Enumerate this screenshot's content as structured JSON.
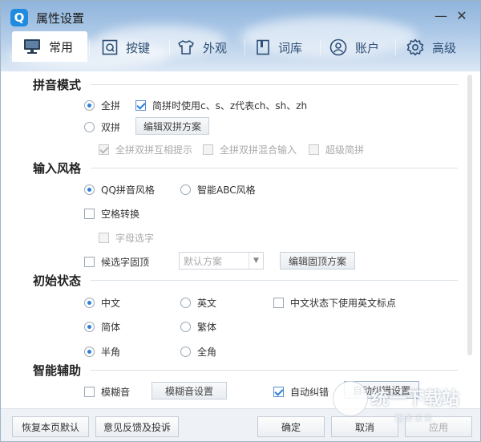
{
  "window": {
    "logo_letter": "Q",
    "title": "属性设置",
    "minimize": "—",
    "close": "✕"
  },
  "tabs": [
    {
      "label": "常用",
      "icon": "monitor-icon",
      "active": true
    },
    {
      "label": "按键",
      "icon": "key-q-icon",
      "active": false
    },
    {
      "label": "外观",
      "icon": "shirt-icon",
      "active": false
    },
    {
      "label": "词库",
      "icon": "book-icon",
      "active": false
    },
    {
      "label": "账户",
      "icon": "user-icon",
      "active": false
    },
    {
      "label": "高级",
      "icon": "gear-icon",
      "active": false
    }
  ],
  "sections": {
    "pinyin_mode": {
      "title": "拼音模式",
      "full_pinyin": "全拼",
      "abbrev_option": "简拼时使用c、s、z代表ch、sh、zh",
      "double_pinyin": "双拼",
      "edit_double_btn": "编辑双拼方案",
      "mutual_hint": "全拼双拼互相提示",
      "mixed_input": "全拼双拼混合输入",
      "super_abbrev": "超级简拼"
    },
    "input_style": {
      "title": "输入风格",
      "qq_style": "QQ拼音风格",
      "abc_style": "智能ABC风格",
      "space_convert": "空格转换",
      "letter_select": "字母选字",
      "fixed_top": "候选字固顶",
      "default_scheme": "默认方案",
      "edit_fixed_btn": "编辑固顶方案"
    },
    "initial_state": {
      "title": "初始状态",
      "chinese": "中文",
      "english": "英文",
      "english_punct": "中文状态下使用英文标点",
      "simplified": "简体",
      "traditional": "繁体",
      "half_width": "半角",
      "full_width": "全角"
    },
    "smart_assist": {
      "title": "智能辅助",
      "fuzzy": "模糊音",
      "fuzzy_btn": "模糊音设置",
      "auto_correct": "自动纠错",
      "auto_correct_btn": "自动纠错设置"
    }
  },
  "footer": {
    "restore_default": "恢复本页默认",
    "feedback": "意见反馈及投诉",
    "ok": "确定",
    "cancel": "取消",
    "apply": "应用"
  },
  "watermark": {
    "text": "统一下载站",
    "sub": "服务未来"
  },
  "colors": {
    "accent": "#2e7fd8",
    "header_top": "#8fb4db",
    "footer_bg": "#eef2f6"
  }
}
